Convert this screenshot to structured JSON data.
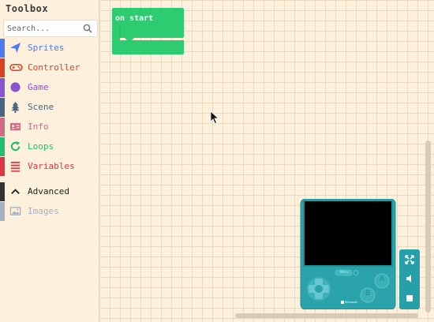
{
  "toolbox": {
    "title": "Toolbox",
    "search_placeholder": "Search...",
    "categories": [
      {
        "label": "Sprites",
        "color": "#4b7bec",
        "icon": "paper-plane-icon"
      },
      {
        "label": "Controller",
        "color": "#d54322",
        "icon": "gamepad-icon"
      },
      {
        "label": "Game",
        "color": "#8854d0",
        "icon": "circle-icon"
      },
      {
        "label": "Scene",
        "color": "#4b6584",
        "icon": "tree-icon"
      },
      {
        "label": "Info",
        "color": "#cf6a87",
        "icon": "id-card-icon"
      },
      {
        "label": "Loops",
        "color": "#20bf6b",
        "icon": "loop-arrow-icon"
      },
      {
        "label": "Variables",
        "color": "#dc3545",
        "icon": "list-lines-icon"
      },
      {
        "label": "Advanced",
        "color": "#333333",
        "icon": "chevron-up-icon"
      },
      {
        "label": "Images",
        "color": "#a5b1c2",
        "icon": "image-icon"
      }
    ]
  },
  "workspace": {
    "block_label": "on start",
    "block_color": "#2ecc71"
  },
  "simulator": {
    "menu_label": "Menu",
    "button_a": "A",
    "button_b": "B",
    "brand": "Microsoft",
    "body_color": "#2ba3ab"
  }
}
